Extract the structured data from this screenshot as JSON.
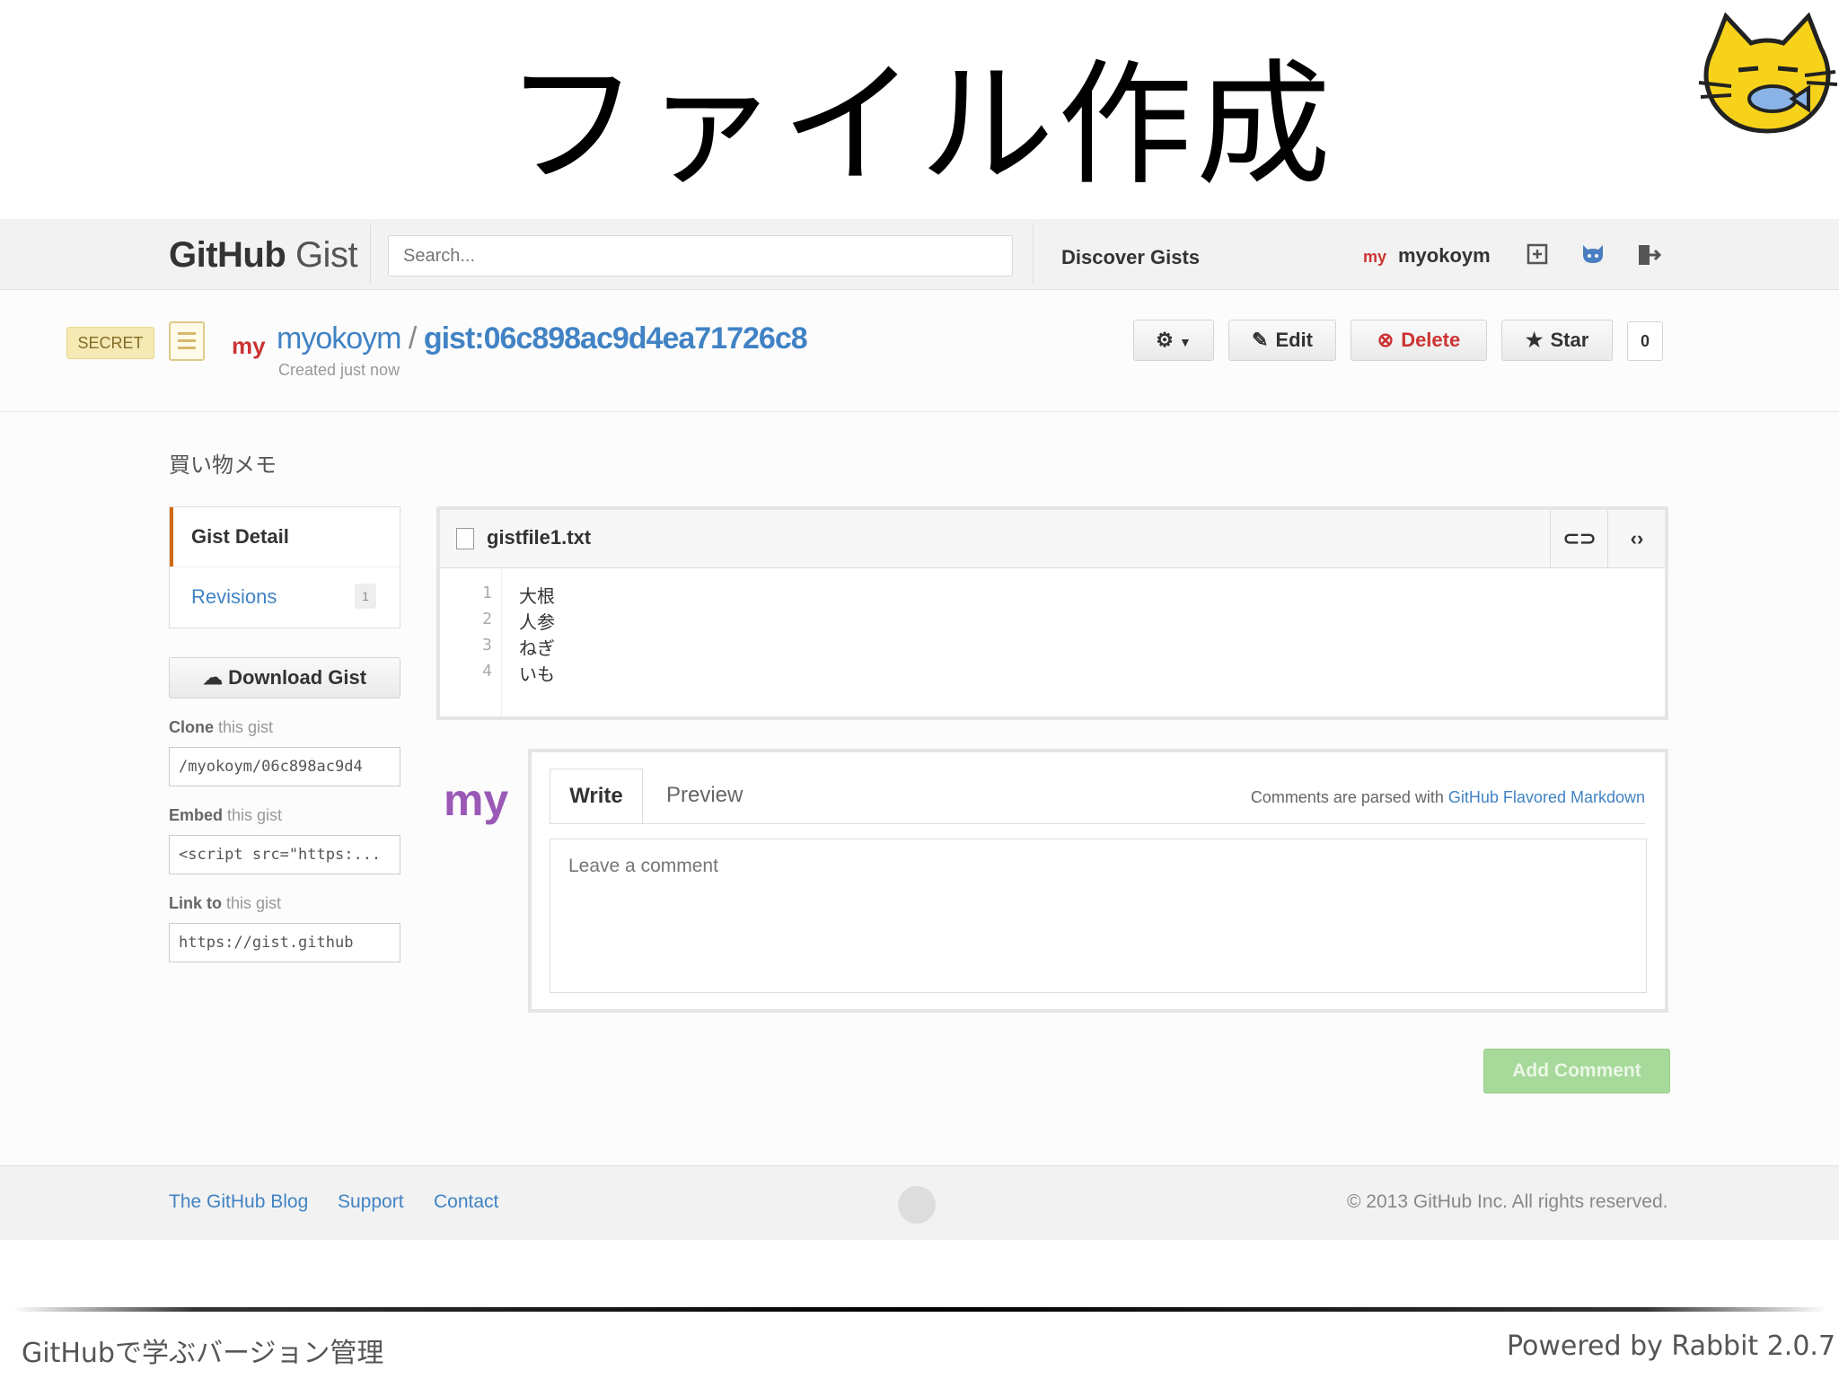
{
  "slide": {
    "title": "ファイル作成",
    "footer_left": "GitHubで学ぶバージョン管理",
    "footer_right": "Powered by Rabbit 2.0.7"
  },
  "header": {
    "logo_github": "GitHub",
    "logo_gist": "Gist",
    "search_placeholder": "Search...",
    "discover": "Discover Gists",
    "avatar_text": "my",
    "username": "myokoym",
    "icons": [
      "new-gist-icon",
      "octocat-icon",
      "sign-out-icon"
    ]
  },
  "gist": {
    "secret_badge": "SECRET",
    "avatar_text": "my",
    "owner": "myokoym",
    "separator": "/",
    "gist_id": "gist:06c898ac9d4ea71726c8",
    "created": "Created just now",
    "buttons": {
      "edit": "Edit",
      "delete": "Delete",
      "star": "Star",
      "star_count": "0"
    },
    "description": "買い物メモ"
  },
  "sidebar": {
    "gist_detail": "Gist Detail",
    "revisions": "Revisions",
    "revisions_count": "1",
    "download": "Download Gist",
    "clone_label_bold": "Clone",
    "clone_label_rest": " this gist",
    "clone_value": "/myokoym/06c898ac9d4",
    "embed_label_bold": "Embed",
    "embed_label_rest": " this gist",
    "embed_value": "<script src=\"https:...",
    "link_label_bold": "Link to",
    "link_label_rest": " this gist",
    "link_value": "https://gist.github"
  },
  "file": {
    "name": "gistfile1.txt",
    "lines": [
      {
        "n": "1",
        "text": "大根"
      },
      {
        "n": "2",
        "text": "人参"
      },
      {
        "n": "3",
        "text": "ねぎ"
      },
      {
        "n": "4",
        "text": "いも"
      }
    ]
  },
  "comment": {
    "avatar_text": "my",
    "tab_write": "Write",
    "tab_preview": "Preview",
    "note_prefix": "Comments are parsed with ",
    "note_link": "GitHub Flavored Markdown",
    "placeholder": "Leave a comment",
    "submit": "Add Comment"
  },
  "footer": {
    "blog": "The GitHub Blog",
    "support": "Support",
    "contact": "Contact",
    "copyright": "© 2013 GitHub Inc. All rights reserved."
  }
}
